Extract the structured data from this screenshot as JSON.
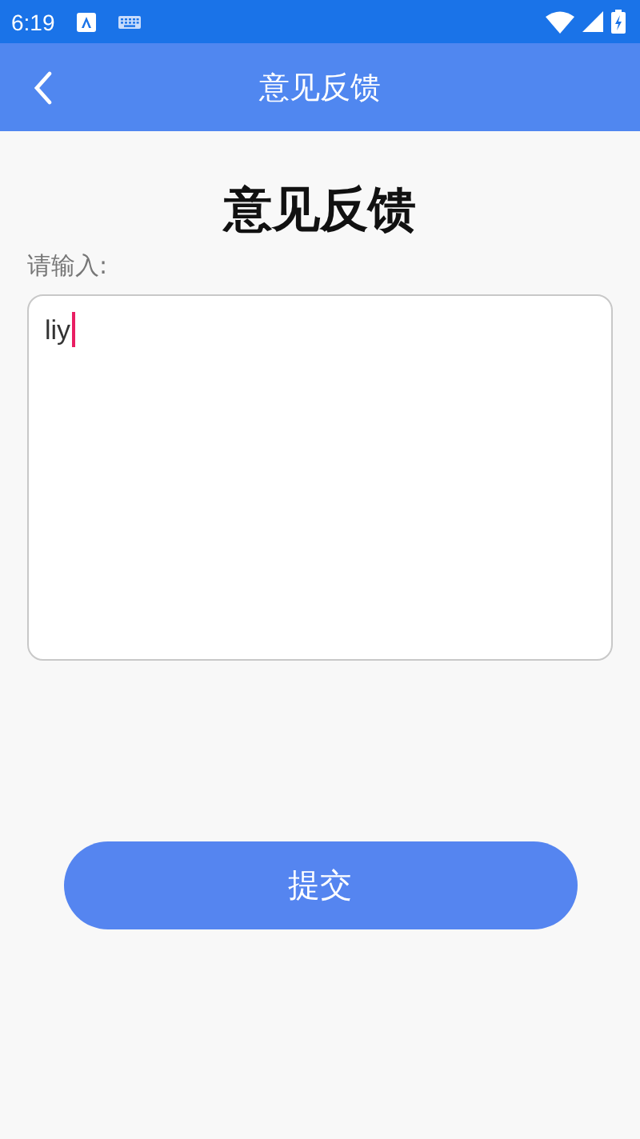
{
  "status_bar": {
    "time": "6:19"
  },
  "app_bar": {
    "title": "意见反馈"
  },
  "heading": "意见反馈",
  "feedback": {
    "label": "请输入:",
    "value": "liy",
    "focused": true
  },
  "buttons": [
    "提交"
  ]
}
